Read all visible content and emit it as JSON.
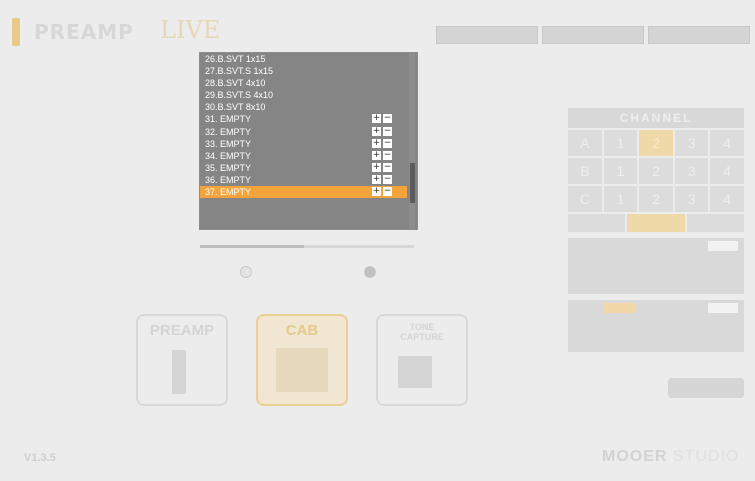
{
  "header": {
    "logo_text": "PREAMP",
    "logo_suffix": "LIVE"
  },
  "modules": {
    "preamp": "PREAMP",
    "cab": "CAB",
    "tone_capture": "TONE\nCAPTURE"
  },
  "channel_panel": {
    "title": "CHANNEL",
    "cells": [
      "A",
      "1",
      "2",
      "3",
      "4",
      "B",
      "1",
      "2",
      "3",
      "4",
      "C",
      "1",
      "2",
      "3",
      "4"
    ]
  },
  "footer": {
    "version": "V1.3.5",
    "brand_main": "MOOER",
    "brand_studio": "STUDIO"
  },
  "dropdown": {
    "items": [
      {
        "label": "26.B.SVT 1x15",
        "buttons": false,
        "selected": false
      },
      {
        "label": "27.B.SVT.S 1x15",
        "buttons": false,
        "selected": false
      },
      {
        "label": "28.B.SVT 4x10",
        "buttons": false,
        "selected": false
      },
      {
        "label": "29.B.SVT.S 4x10",
        "buttons": false,
        "selected": false
      },
      {
        "label": "30.B.SVT 8x10",
        "buttons": false,
        "selected": false
      },
      {
        "label": "31. EMPTY",
        "buttons": true,
        "selected": false
      },
      {
        "label": "32. EMPTY",
        "buttons": true,
        "selected": false
      },
      {
        "label": "33. EMPTY",
        "buttons": true,
        "selected": false
      },
      {
        "label": "34. EMPTY",
        "buttons": true,
        "selected": false
      },
      {
        "label": "35. EMPTY",
        "buttons": true,
        "selected": false
      },
      {
        "label": "36. EMPTY",
        "buttons": true,
        "selected": false
      },
      {
        "label": "37. EMPTY",
        "buttons": true,
        "selected": true
      }
    ],
    "plus_symbol": "+",
    "minus_symbol": "−"
  },
  "colors": {
    "accent": "#f2a33a",
    "dropdown_bg": "#858585"
  }
}
